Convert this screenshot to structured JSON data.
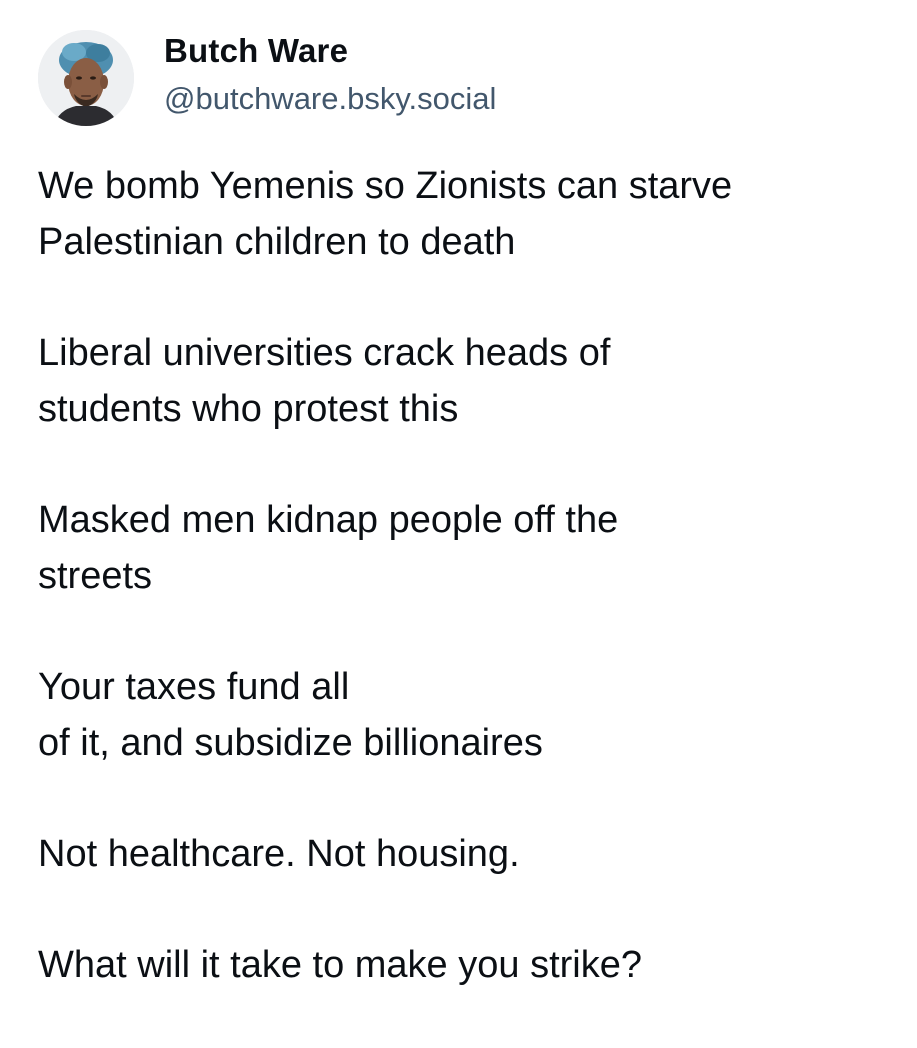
{
  "post": {
    "author": {
      "display_name": "Butch Ware",
      "handle": "@butchware.bsky.social",
      "avatar_icon": "person-portrait-icon"
    },
    "paragraphs": [
      {
        "lines": [
          "We bomb Yemenis so Zionists can starve",
          "Palestinian children to death"
        ]
      },
      {
        "lines": [
          "Liberal universities crack heads of",
          "students who protest this"
        ]
      },
      {
        "lines": [
          "Masked men kidnap people off the",
          "streets"
        ]
      },
      {
        "lines": [
          "Your taxes fund all",
          "of it, and subsidize billionaires"
        ]
      },
      {
        "lines": [
          "Not healthcare. Not housing."
        ]
      },
      {
        "lines": [
          "What will it take to make you strike?"
        ]
      }
    ]
  }
}
